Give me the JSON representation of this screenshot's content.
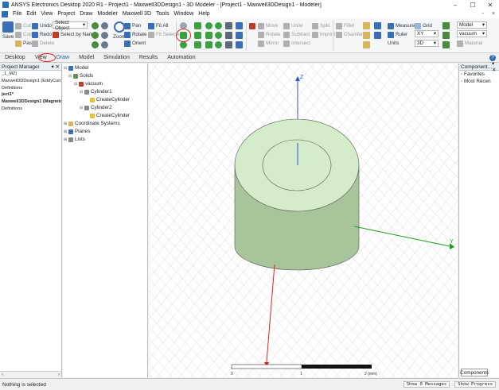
{
  "window": {
    "title": "ANSYS Electronics Desktop 2020 R1 - Project1 - Maxwell3DDesign1 - 3D Modeler - [Project1 - Maxwell3DDesign1 - Modeler]",
    "minimize": "–",
    "maximize": "☐",
    "close": "✕"
  },
  "menu": {
    "items": [
      "File",
      "Edit",
      "View",
      "Project",
      "Draw",
      "Modeler",
      "Maxwell 3D",
      "Tools",
      "Window",
      "Help"
    ],
    "right_min": "-",
    "right_close": "×"
  },
  "ribbon": {
    "save": "Save",
    "cut": "Cut",
    "copy": "Copy",
    "paste": "Paste",
    "undo": "Undo",
    "redo": "Redo",
    "delete": "Delete",
    "select_object": "Select Object",
    "select_by_name": "Select by Name",
    "zoom": "Zoom",
    "pan": "Pan",
    "rotate": "Rotate",
    "orient": "Orient",
    "fit_all": "Fit All",
    "fit_selected": "Fit Selected",
    "move": "Move",
    "rotate2": "Rotate",
    "mirror": "Mirror",
    "unite": "Unite",
    "subtract": "Subtract",
    "intersect": "Intersect",
    "split": "Split",
    "imprint": "Imprint",
    "fillet": "Fillet",
    "chamfer": "Chamfer",
    "measure": "Measure",
    "ruler": "Ruler",
    "units": "Units",
    "grid": "Grid",
    "plane": "XY",
    "dimension": "3D",
    "model": "Model",
    "material_value": "vacuum",
    "material": "Material"
  },
  "tabs": [
    "Desktop",
    "View",
    "Draw",
    "Model",
    "Simulation",
    "Results",
    "Automation"
  ],
  "active_tab": "Draw",
  "help_icon": "?",
  "project_manager": {
    "title": "Project Manager",
    "head_icons": "▾ ✕",
    "lines": [
      {
        "text": "_1_MZ)",
        "bold": false
      },
      {
        "text": "Maxwell3DDesign1 (EddyCurrent)",
        "bold": false
      },
      {
        "text": "Definitions",
        "bold": false
      },
      {
        "text": "ject1*",
        "bold": true
      },
      {
        "text": "Maxwell3DDesign1 (Magnetostatic)",
        "bold": true
      },
      {
        "text": "Definitions",
        "bold": false
      }
    ],
    "scroll_left": "‹",
    "scroll_right": "›"
  },
  "model_tree": {
    "model": "Model",
    "solids": "Solids",
    "vacuum": "vacuum",
    "cylinder1": "Cylinder1",
    "create1": "CreateCylinder",
    "cylinder2": "Cylinder2",
    "create2": "CreateCylinder",
    "coord": "Coordinate Systems",
    "planes": "Planes",
    "lists": "Lists"
  },
  "viewport": {
    "axis_z": "Z",
    "axis_y": "Y",
    "scale_labels": [
      "0",
      "1",
      "2 (mm)"
    ],
    "colors": {
      "cylinder_top": "#d4ecca",
      "cylinder_side": "#a8c49a",
      "grid": "#d8d8d8",
      "axis_z": "#2a55d6",
      "axis_y": "#19a019",
      "axis_x": "#e02020"
    }
  },
  "components": {
    "title": "Component...",
    "head_icons": "▾ ✕",
    "items": [
      "Favorites",
      "Most Recen"
    ],
    "tab": "Components"
  },
  "status": {
    "text": "Nothing is selected",
    "messages": "Show 0 Messages",
    "progress": "Show Progress"
  }
}
